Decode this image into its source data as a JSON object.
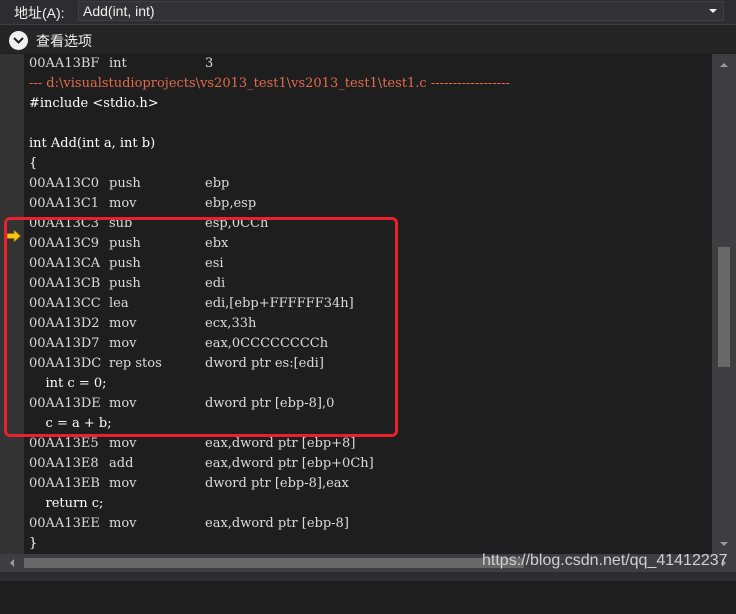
{
  "address_bar": {
    "label": "地址(A):",
    "value": "Add(int, int)"
  },
  "view_options": {
    "label": "查看选项"
  },
  "header_line": {
    "addr": "00AA13BF",
    "op": "int",
    "args": "3"
  },
  "source_header": "--- d:\\visualstudioprojects\\vs2013_test1\\vs2013_test1\\test1.c ------------------",
  "source_lines": {
    "include": "#include <stdio.h>",
    "blank": "",
    "func_sig": "int Add(int a, int b)",
    "open_brace": "{",
    "decl_c": "    int c = 0;",
    "assign_c": "    c = a + b;",
    "ret": "    return c;",
    "close_brace": "}"
  },
  "prologue": [
    {
      "addr": "00AA13C0",
      "op": "push",
      "args": "ebp"
    },
    {
      "addr": "00AA13C1",
      "op": "mov",
      "args": "ebp,esp"
    },
    {
      "addr": "00AA13C3",
      "op": "sub",
      "args": "esp,0CCh"
    },
    {
      "addr": "00AA13C9",
      "op": "push",
      "args": "ebx"
    },
    {
      "addr": "00AA13CA",
      "op": "push",
      "args": "esi"
    },
    {
      "addr": "00AA13CB",
      "op": "push",
      "args": "edi"
    },
    {
      "addr": "00AA13CC",
      "op": "lea",
      "args": "edi,[ebp+FFFFFF34h]"
    },
    {
      "addr": "00AA13D2",
      "op": "mov",
      "args": "ecx,33h"
    },
    {
      "addr": "00AA13D7",
      "op": "mov",
      "args": "eax,0CCCCCCCCh"
    },
    {
      "addr": "00AA13DC",
      "op": "rep stos",
      "args": "dword ptr es:[edi]"
    }
  ],
  "after_decl": [
    {
      "addr": "00AA13DE",
      "op": "mov",
      "args": "dword ptr [ebp-8],0"
    }
  ],
  "after_assign": [
    {
      "addr": "00AA13E5",
      "op": "mov",
      "args": "eax,dword ptr [ebp+8]"
    },
    {
      "addr": "00AA13E8",
      "op": "add",
      "args": "eax,dword ptr [ebp+0Ch]"
    },
    {
      "addr": "00AA13EB",
      "op": "mov",
      "args": "dword ptr [ebp-8],eax"
    }
  ],
  "after_return": [
    {
      "addr": "00AA13EE",
      "op": "mov",
      "args": "eax,dword ptr [ebp-8]"
    }
  ],
  "watermark": "https://blog.csdn.net/qq_41412237",
  "colors": {
    "highlight_border": "#e8212e",
    "source_header": "#e06c4c",
    "current_instruction_arrow": "#f5c518"
  }
}
